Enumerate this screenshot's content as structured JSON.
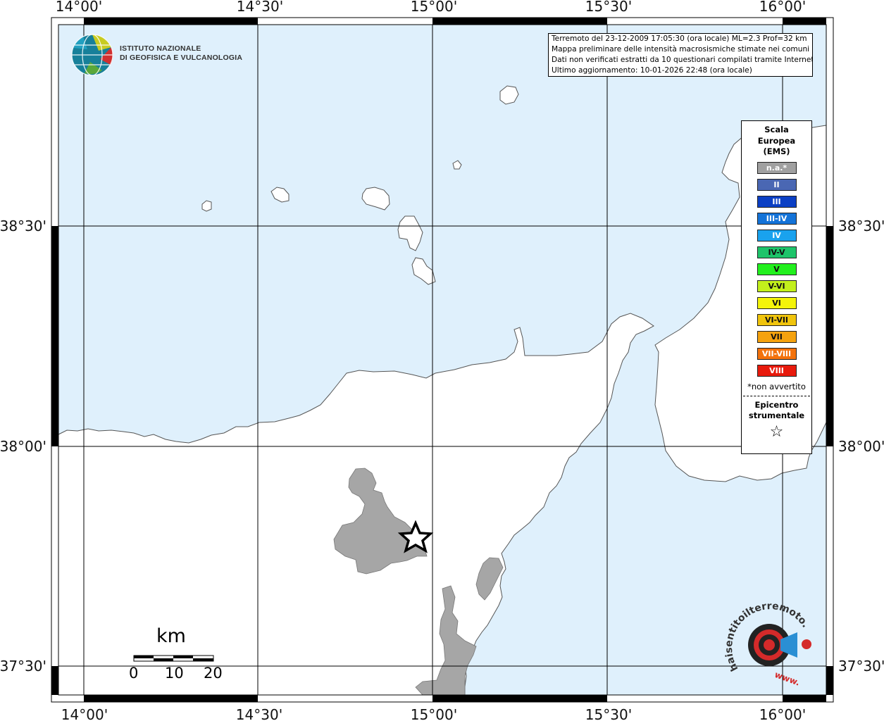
{
  "info_lines": [
    "Terremoto del 23-12-2009 17:05:30 (ora locale) ML=2.3 Prof=32 km",
    "Mappa preliminare delle intensità macrosismiche stimate nei comuni",
    "Dati non verificati estratti da 10 questionari compilati tramite Internet.",
    "Ultimo aggiornamento: 10-01-2026 22:48 (ora locale)"
  ],
  "top_ticks": [
    "14°00'",
    "14°30'",
    "15°00'",
    "15°30'",
    "16°00'"
  ],
  "bottom_ticks": [
    "14°00'",
    "14°30'",
    "15°00'",
    "15°30'",
    "16°00'"
  ],
  "left_ticks": [
    "38°30'",
    "38°00'",
    "37°30'"
  ],
  "right_ticks": [
    "38°30'",
    "38°00'",
    "37°30'"
  ],
  "legend": {
    "title_lines": [
      "Scala",
      "Europea",
      "(EMS)"
    ],
    "classes": [
      {
        "label": "n.a.*",
        "color": "#a0a0a0",
        "text_dark": false
      },
      {
        "label": "II",
        "color": "#4a67b3",
        "text_dark": false
      },
      {
        "label": "III",
        "color": "#0b3fc4",
        "text_dark": false
      },
      {
        "label": "III-IV",
        "color": "#1473d8",
        "text_dark": false
      },
      {
        "label": "IV",
        "color": "#19a2ee",
        "text_dark": false
      },
      {
        "label": "IV-V",
        "color": "#1ec46a",
        "text_dark": true
      },
      {
        "label": "V",
        "color": "#22f01e",
        "text_dark": true
      },
      {
        "label": "V-VI",
        "color": "#c2f01c",
        "text_dark": true
      },
      {
        "label": "VI",
        "color": "#f4f40a",
        "text_dark": true
      },
      {
        "label": "VI-VII",
        "color": "#f0c40c",
        "text_dark": true
      },
      {
        "label": "VII",
        "color": "#f5a20e",
        "text_dark": true
      },
      {
        "label": "VII-VIII",
        "color": "#f4720c",
        "text_dark": false
      },
      {
        "label": "VIII",
        "color": "#e81a0c",
        "text_dark": false
      }
    ],
    "note": "*non avvertito",
    "epicenter_lines": [
      "Epicentro",
      "strumentale"
    ],
    "epicenter_symbol": "☆"
  },
  "logo": {
    "line1": "ISTITUTO NAZIONALE",
    "line2": "DI GEOFISICA E VULCANOLOGIA"
  },
  "watermark": {
    "text": "haisentitoilterremoto.it",
    "prefix": "www."
  },
  "scalebar": {
    "unit": "km",
    "labels": [
      "0",
      "10",
      "20"
    ]
  },
  "colors": {
    "sea": "#dff0fc",
    "land": "#ffffff",
    "etna": "#a6a6a6",
    "grid": "#000000",
    "coast": "#555555"
  }
}
